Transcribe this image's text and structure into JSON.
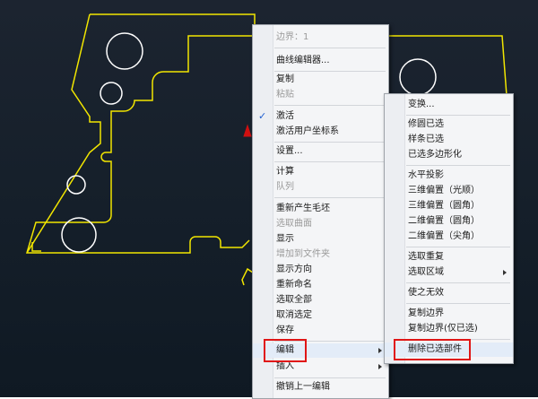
{
  "main_menu": {
    "items": [
      {
        "label": "边界：1",
        "disabled": true
      },
      {
        "label": "曲线编辑器..."
      },
      {
        "label": "复制"
      },
      {
        "label": "粘贴",
        "disabled": true
      },
      {
        "label": "激活",
        "checked": true
      },
      {
        "label": "激活用户坐标系"
      },
      {
        "label": "设置..."
      },
      {
        "label": "计算"
      },
      {
        "label": "队列",
        "disabled": true
      },
      {
        "label": "重新产生毛坯"
      },
      {
        "label": "选取曲面",
        "disabled": true
      },
      {
        "label": "显示"
      },
      {
        "label": "增加到文件夹",
        "disabled": true
      },
      {
        "label": "显示方向"
      },
      {
        "label": "重新命名"
      },
      {
        "label": "选取全部"
      },
      {
        "label": "取消选定"
      },
      {
        "label": "保存"
      },
      {
        "label": "编辑",
        "submenu": true,
        "highlighted": true
      },
      {
        "label": "插入",
        "submenu": true
      },
      {
        "label": "撤销上一编辑"
      }
    ],
    "check_glyph": "✓"
  },
  "sub_menu": {
    "items": [
      {
        "label": "变换..."
      },
      {
        "label": "修圆已选"
      },
      {
        "label": "样条已选"
      },
      {
        "label": "已选多边形化"
      },
      {
        "label": "水平投影"
      },
      {
        "label": "三维偏置（光顺）"
      },
      {
        "label": "三维偏置（圆角）"
      },
      {
        "label": "二维偏置（圆角）"
      },
      {
        "label": "二维偏置（尖角）"
      },
      {
        "label": "选取重复"
      },
      {
        "label": "选取区域",
        "submenu": true
      },
      {
        "label": "使之无效"
      },
      {
        "label": "复制边界"
      },
      {
        "label": "复制边界(仅已选)"
      },
      {
        "label": "删除已选部件",
        "highlighted": true
      }
    ]
  },
  "colors": {
    "highlight_border": "#e01616",
    "cad_line": "#f2e600",
    "cad_circle": "#ffffff",
    "background": "#1a232e"
  }
}
